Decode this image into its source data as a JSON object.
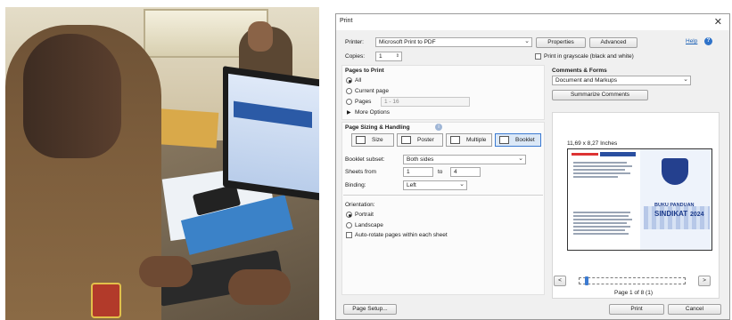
{
  "dialog": {
    "title": "Print",
    "printer_label": "Printer:",
    "printer_value": "Microsoft Print to PDF",
    "properties_label": "Properties",
    "advanced_label": "Advanced",
    "help_label": "Help",
    "copies_label": "Copies:",
    "copies_value": "1",
    "grayscale_label": "Print in grayscale (black and white)",
    "pages_section": "Pages to Print",
    "all_label": "All",
    "current_page_label": "Current page",
    "pages_label": "Pages",
    "pages_value": "1 - 16",
    "more_options_label": "More Options",
    "sizing_section": "Page Sizing & Handling",
    "tabs": [
      {
        "label": "Size",
        "icon": "size-icon"
      },
      {
        "label": "Poster",
        "icon": "poster-icon"
      },
      {
        "label": "Multiple",
        "icon": "multiple-icon"
      },
      {
        "label": "Booklet",
        "icon": "booklet-icon",
        "selected": true
      }
    ],
    "booklet_subset_label": "Booklet subset:",
    "booklet_subset_value": "Both sides",
    "sheets_from_label": "Sheets from",
    "sheets_from_value": "1",
    "sheets_to_label": "to",
    "sheets_to_value": "4",
    "binding_label": "Binding:",
    "binding_value": "Left",
    "orientation_label": "Orientation:",
    "portrait_label": "Portrait",
    "landscape_label": "Landscape",
    "auto_rotate_label": "Auto-rotate pages within each sheet",
    "comments_section": "Comments & Forms",
    "comments_value": "Document and Markups",
    "summarize_label": "Summarize Comments",
    "preview_size": "11,69 x 8,27 Inches",
    "preview_title_line1": "BUKU PANDUAN",
    "preview_title_line2": "SINDIKAT",
    "preview_year": "2024",
    "prev_page_glyph": "<",
    "next_page_glyph": ">",
    "page_indicator": "Page 1 of 8 (1)",
    "page_setup_label": "Page Setup...",
    "print_label": "Print",
    "cancel_label": "Cancel",
    "accent_color": "#3b7ad1"
  }
}
